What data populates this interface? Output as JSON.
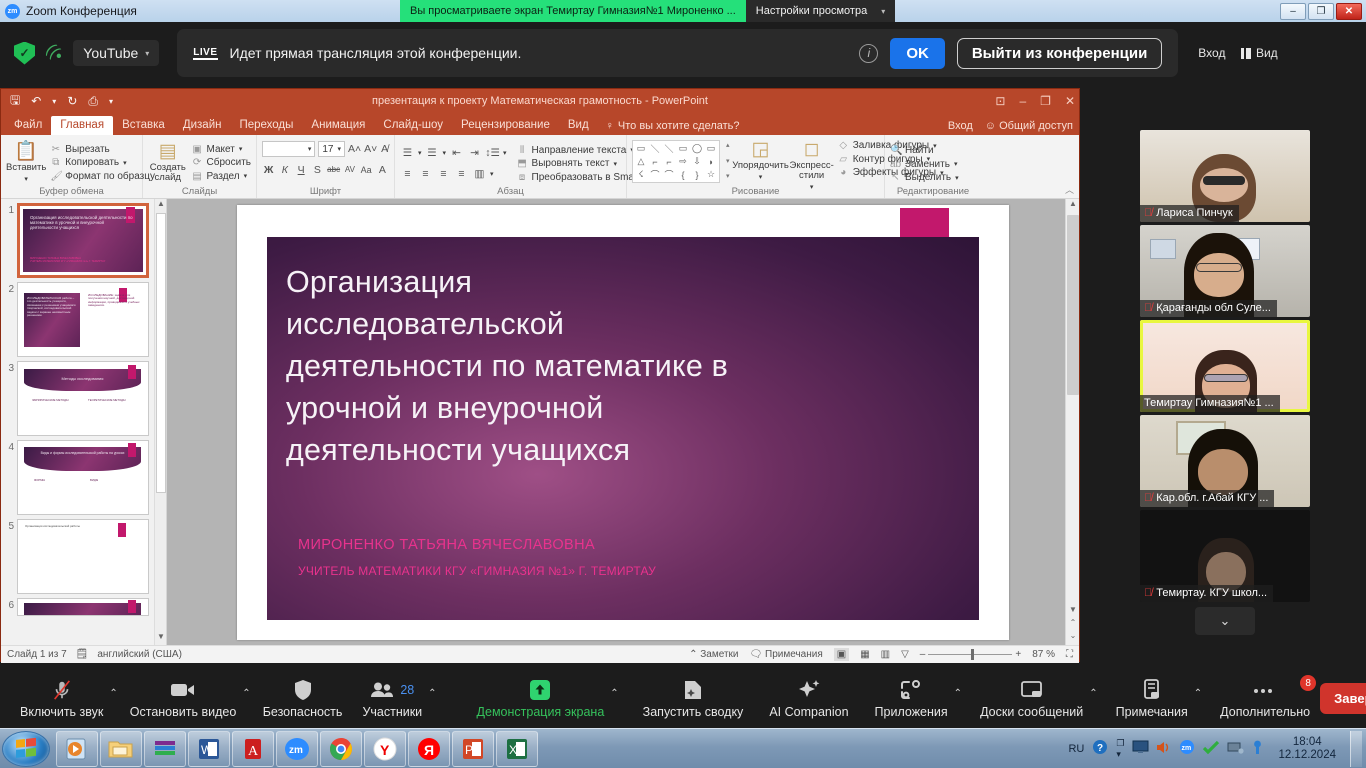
{
  "zoom_window": {
    "titlebar": {
      "app_name": "Zoom Конференция",
      "logo_text": "zm",
      "sharing_notice": "Вы просматриваете экран Темиртау Гимназия№1 Мироненко ...",
      "view_options": "Настройки просмотра",
      "minimize": "–",
      "restore": "❐",
      "close": "✕"
    },
    "banner": {
      "shield_icon": "shield-check-icon",
      "stream_icon": "broadcast-icon",
      "platform": "YouTube",
      "live_label": "LIVE",
      "message": "Идет прямая трансляция этой конференции.",
      "info_icon": "info-icon",
      "ok_label": "OK",
      "leave_label": "Выйти из конференции",
      "login_label": "Вход",
      "view_label": "Вид"
    }
  },
  "powerpoint": {
    "document_title": "презентация к проекту Математическая грамотность - PowerPoint",
    "quick_access": [
      "save-icon",
      "undo-icon",
      "redo-icon",
      "start-slideshow-icon",
      "customize-icon"
    ],
    "window_buttons": {
      "ribbon_options": "⊡",
      "minimize": "–",
      "restore": "❐",
      "close": "✕"
    },
    "account": {
      "signin": "Вход",
      "share": "Общий доступ"
    },
    "tabs": [
      {
        "label": "Файл",
        "active": false
      },
      {
        "label": "Главная",
        "active": true
      },
      {
        "label": "Вставка",
        "active": false
      },
      {
        "label": "Дизайн",
        "active": false
      },
      {
        "label": "Переходы",
        "active": false
      },
      {
        "label": "Анимация",
        "active": false
      },
      {
        "label": "Слайд-шоу",
        "active": false
      },
      {
        "label": "Рецензирование",
        "active": false
      },
      {
        "label": "Вид",
        "active": false
      }
    ],
    "tell_me": "Что вы хотите сделать?",
    "ribbon": {
      "clipboard": {
        "group_label": "Буфер обмена",
        "paste": "Вставить",
        "cut": "Вырезать",
        "copy": "Копировать",
        "format_painter": "Формат по образцу"
      },
      "slides": {
        "group_label": "Слайды",
        "new_slide": "Создать слайд",
        "layout": "Макет",
        "reset": "Сбросить",
        "section": "Раздел"
      },
      "font": {
        "group_label": "Шрифт",
        "font_name": "",
        "font_size": "17",
        "grow": "A",
        "shrink": "A",
        "clear_format": "A",
        "bold": "Ж",
        "italic": "К",
        "underline": "Ч",
        "shadow": "S",
        "strike": "abc",
        "spacing": "AV",
        "case": "Aa",
        "color": "A"
      },
      "paragraph": {
        "group_label": "Абзац",
        "text_direction": "Направление текста",
        "align_text": "Выровнять текст",
        "convert_smartart": "Преобразовать в SmartArt"
      },
      "drawing": {
        "group_label": "Рисование",
        "arrange": "Упорядочить",
        "quick_styles": "Экспресс-стили",
        "shape_fill": "Заливка фигуры",
        "shape_outline": "Контур фигуры",
        "shape_effects": "Эффекты фигуры"
      },
      "editing": {
        "group_label": "Редактирование",
        "find": "Найти",
        "replace": "Заменить",
        "select": "Выделить"
      }
    },
    "thumbnails": [
      {
        "number": "1",
        "selected": true,
        "kind": "title",
        "lines": [
          "Организация",
          "исследовательской",
          "деятельности по математике в",
          "урочной и внеурочной",
          "деятельности учащихся"
        ],
        "sub": [
          "МИРОНЕНКО ТАТЬЯНА ВЯЧЕСЛАВОВНА",
          "УЧИТЕЛЬ МАТЕМАТИКИ КГУ «ГИМНАЗИЯ №1» Г. ТЕМИРТАУ"
        ]
      },
      {
        "number": "2",
        "selected": false,
        "kind": "twocol",
        "lines": [
          "ИССЛЕДОВАТЕЛЬСКАЯ работа – это деятельность учащихся, связанная с решением учащимися творческой, исследовательской задачи с заранее неизвестным решением."
        ],
        "sub": [
          "ИССЛЕДОВАНИЕ — задача для получения научной, достоверной информации..."
        ]
      },
      {
        "number": "3",
        "selected": false,
        "kind": "banner",
        "lines": [
          "Методы исследования"
        ],
        "sub": [
          "ЭМПИРИЧЕСКИЕ МЕТОДЫ",
          "ТЕОРЕТИЧЕСКИЕ МЕТОДЫ"
        ]
      },
      {
        "number": "4",
        "selected": false,
        "kind": "banner",
        "lines": [
          "Виды и формы  исследовательской работы на уроках"
        ],
        "sub": [
          "ФОРМЫ",
          "ВИДЫ"
        ]
      },
      {
        "number": "5",
        "selected": false,
        "kind": "plain",
        "lines": [
          "Организация исследовательской работы"
        ],
        "sub": []
      },
      {
        "number": "6",
        "selected": false,
        "kind": "banner",
        "lines": [
          ""
        ],
        "sub": []
      }
    ],
    "slide": {
      "title_lines": [
        "Организация",
        "исследовательской",
        "деятельности по математике в",
        "урочной и внеурочной",
        "деятельности учащихся"
      ],
      "author": "МИРОНЕНКО ТАТЬЯНА ВЯЧЕСЛАВОВНА",
      "affiliation": "УЧИТЕЛЬ МАТЕМАТИКИ КГУ «ГИМНАЗИЯ №1» Г. ТЕМИРТАУ",
      "accent_color": "#c2186c"
    },
    "status_bar": {
      "slide_counter": "Слайд 1 из 7",
      "language": "английский (США)",
      "notes": "Заметки",
      "comments": "Примечания",
      "view_normal": "normal-view-icon",
      "view_sorter": "slide-sorter-icon",
      "view_reading": "reading-view-icon",
      "view_slideshow": "slideshow-icon",
      "zoom_out": "–",
      "zoom_in": "+",
      "zoom_level": "87 %",
      "fit_icon": "fit-to-window-icon"
    }
  },
  "participants_strip": [
    {
      "name": "Лариса Пинчук",
      "muted": true,
      "active": false,
      "bg": "#cfc3ae",
      "top": "#e9e4dc"
    },
    {
      "name": "Қарағанды обл Суле...",
      "muted": true,
      "active": false,
      "bg": "#b6b3ab",
      "top": "#d5d3cd"
    },
    {
      "name": "Темиртау Гимназия№1 ...",
      "muted": false,
      "active": true,
      "bg": "#f4ddd0",
      "top": "#f7e8e0"
    },
    {
      "name": "Кар.обл. г.Абай КГУ ...",
      "muted": true,
      "active": false,
      "bg": "#cdc6b6",
      "top": "#ded9cd"
    },
    {
      "name": "Темиртау. КГУ школ...",
      "muted": true,
      "active": false,
      "bg": "#131313",
      "top": "#1d1d1d"
    }
  ],
  "strip_more_icon": "chevron-down-icon",
  "zoom_toolbar": [
    {
      "label": "Включить звук",
      "icon": "mic-muted-icon",
      "chevron": true,
      "green": false
    },
    {
      "label": "Остановить видео",
      "icon": "camera-icon",
      "chevron": true,
      "green": false
    },
    {
      "label": "Безопасность",
      "icon": "shield-icon",
      "chevron": false,
      "green": false
    },
    {
      "label": "Участники",
      "icon": "participants-icon",
      "chevron": true,
      "green": false,
      "count": "28"
    },
    {
      "label": "Демонстрация экрана",
      "icon": "share-screen-icon",
      "chevron": true,
      "green": true
    },
    {
      "label": "Запустить сводку",
      "icon": "summary-icon",
      "chevron": false,
      "green": false
    },
    {
      "label": "AI Companion",
      "icon": "ai-sparkle-icon",
      "chevron": false,
      "green": false
    },
    {
      "label": "Приложения",
      "icon": "apps-icon",
      "chevron": true,
      "green": false
    },
    {
      "label": "Доски сообщений",
      "icon": "whiteboard-icon",
      "chevron": true,
      "green": false
    },
    {
      "label": "Примечания",
      "icon": "notes-icon",
      "chevron": true,
      "green": false
    },
    {
      "label": "Дополнительно",
      "icon": "more-dots-icon",
      "chevron": false,
      "green": false,
      "badge": "8"
    }
  ],
  "end_button": "Завершение",
  "taskbar": {
    "start_icon": "windows-start-icon",
    "apps": [
      {
        "name": "media-player-icon",
        "color": "#e07b20"
      },
      {
        "name": "file-explorer-icon",
        "color": "#f2c94c"
      },
      {
        "name": "winrar-icon",
        "color": "#7a2a8a"
      },
      {
        "name": "word-icon",
        "color": "#2b5797"
      },
      {
        "name": "adobe-reader-icon",
        "color": "#cc1f1f"
      },
      {
        "name": "zoom-icon",
        "color": "#2d8cff"
      },
      {
        "name": "chrome-icon",
        "color": "#4285f4"
      },
      {
        "name": "yandex-browser-icon",
        "color": "#ffffff"
      },
      {
        "name": "yandex-icon",
        "color": "#ff0000"
      },
      {
        "name": "powerpoint-icon",
        "color": "#d24726"
      },
      {
        "name": "excel-icon",
        "color": "#1d6f42"
      }
    ],
    "tray": {
      "language": "RU",
      "icons": [
        "help-icon",
        "hidden-icons-icon",
        "display-icon",
        "volume-icon",
        "zoom-tray-icon",
        "antivirus-icon",
        "network-icon",
        "security-icon"
      ],
      "time": "18:04",
      "date": "12.12.2024"
    }
  }
}
